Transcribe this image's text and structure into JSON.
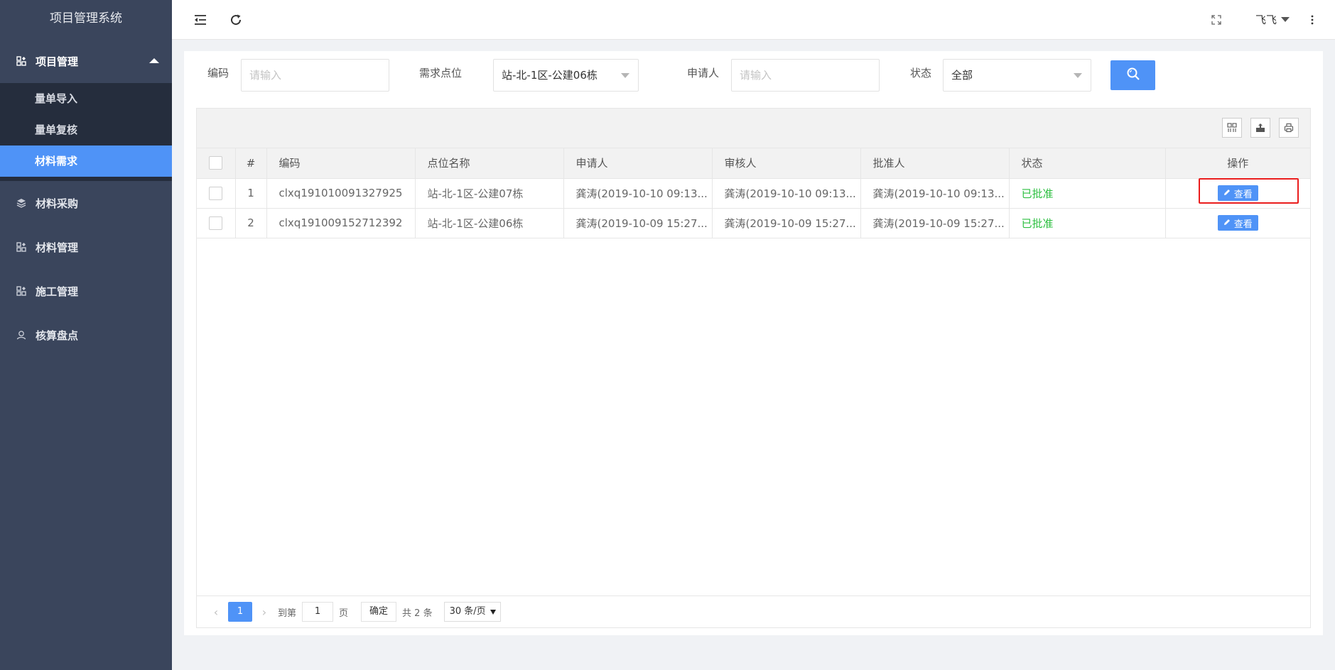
{
  "app": {
    "title": "项目管理系统"
  },
  "sidebar": {
    "group": {
      "label": "项目管理",
      "icon": "grid-icon"
    },
    "subitems": [
      {
        "label": "量单导入"
      },
      {
        "label": "量单复核"
      },
      {
        "label": "材料需求",
        "active": true
      }
    ],
    "items": [
      {
        "label": "材料采购",
        "icon": "layers-icon"
      },
      {
        "label": "材料管理",
        "icon": "grid-icon"
      },
      {
        "label": "施工管理",
        "icon": "grid-icon"
      },
      {
        "label": "核算盘点",
        "icon": "user-icon"
      }
    ]
  },
  "topbar": {
    "user": "飞飞"
  },
  "filters": {
    "code_label": "编码",
    "code_placeholder": "请输入",
    "location_label": "需求点位",
    "location_value": "站-北-1区-公建06栋",
    "applicant_label": "申请人",
    "applicant_placeholder": "请输入",
    "status_label": "状态",
    "status_value": "全部"
  },
  "table": {
    "headers": [
      "#",
      "编码",
      "点位名称",
      "申请人",
      "审核人",
      "批准人",
      "状态",
      "操作"
    ],
    "rows": [
      {
        "num": "1",
        "code": "clxq191010091327925",
        "location": "站-北-1区-公建07栋",
        "applicant": "龚涛(2019-10-10 09:13...",
        "reviewer": "龚涛(2019-10-10 09:13...",
        "approver": "龚涛(2019-10-10 09:13...",
        "status": "已批准",
        "action": "查看"
      },
      {
        "num": "2",
        "code": "clxq191009152712392",
        "location": "站-北-1区-公建06栋",
        "applicant": "龚涛(2019-10-09 15:27...",
        "reviewer": "龚涛(2019-10-09 15:27...",
        "approver": "龚涛(2019-10-09 15:27...",
        "status": "已批准",
        "action": "查看"
      }
    ]
  },
  "pager": {
    "current": "1",
    "goto_label": "到第",
    "goto_value": "1",
    "page_unit": "页",
    "confirm": "确定",
    "total": "共 2 条",
    "page_size": "30 条/页"
  },
  "colors": {
    "accent": "#4f93f7",
    "sidebar_bg": "#3a455c",
    "status_ok": "#2bbf3f",
    "highlight": "#ea1d1d"
  }
}
